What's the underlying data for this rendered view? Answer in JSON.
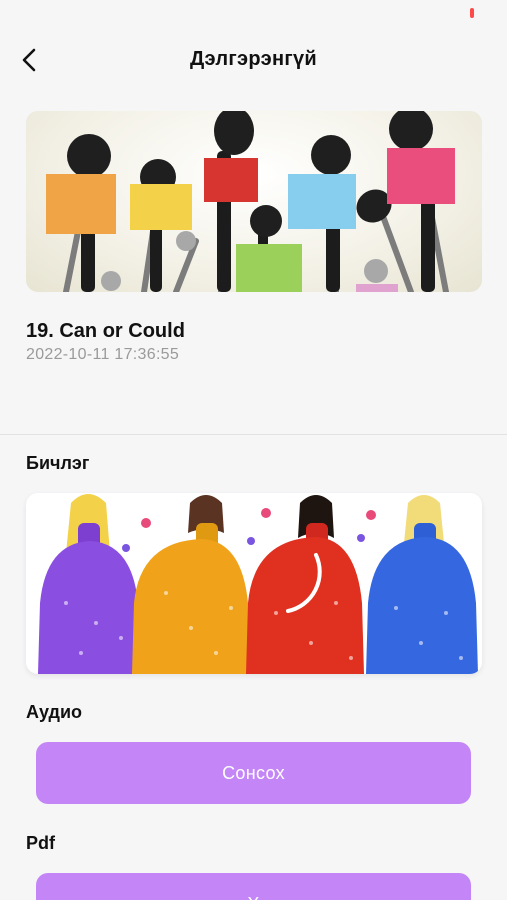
{
  "header": {
    "title": "Дэлгэрэнгүй"
  },
  "post": {
    "title": "19. Can or Could",
    "date": "2022-10-11 17:36:55"
  },
  "sections": {
    "recording_label": "Бичлэг",
    "audio_label": "Аудио",
    "pdf_label": "Pdf"
  },
  "buttons": {
    "listen": "Сонсох",
    "pdf_partial": "Х"
  },
  "colors": {
    "accent": "#c486f7",
    "status_battery": "#ff4a4a"
  },
  "icons": {
    "back": "chevron-left-icon",
    "video_progress": "progress-arc-icon"
  }
}
